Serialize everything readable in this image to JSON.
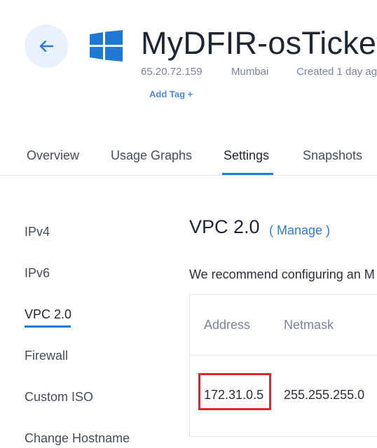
{
  "header": {
    "back_icon": "arrow-left-icon",
    "os_icon": "windows-logo-icon",
    "title": "MyDFIR-osTicket",
    "ip": "65.20.72.159",
    "location": "Mumbai",
    "created": "Created 1 day ag",
    "add_tag": "Add Tag +"
  },
  "tabs": [
    {
      "label": "Overview"
    },
    {
      "label": "Usage Graphs"
    },
    {
      "label": "Settings"
    },
    {
      "label": "Snapshots"
    }
  ],
  "active_tab": "Settings",
  "sidebar": {
    "items": [
      {
        "label": "IPv4"
      },
      {
        "label": "IPv6"
      },
      {
        "label": "VPC 2.0"
      },
      {
        "label": "Firewall"
      },
      {
        "label": "Custom ISO"
      },
      {
        "label": "Change Hostname"
      }
    ],
    "active": "VPC 2.0"
  },
  "vpc": {
    "title": "VPC 2.0",
    "manage": "( Manage )",
    "recommend": "We recommend configuring an M",
    "table": {
      "headers": [
        "Address",
        "Netmask"
      ],
      "rows": [
        [
          "172.31.0.5",
          "255.255.255.0"
        ]
      ]
    }
  },
  "colors": {
    "accent": "#1a7fd4",
    "link": "#2b7bd6",
    "back_button_bg": "#e8f0fb",
    "windows_logo": "#1f78d1",
    "highlight": "#e0262e"
  }
}
